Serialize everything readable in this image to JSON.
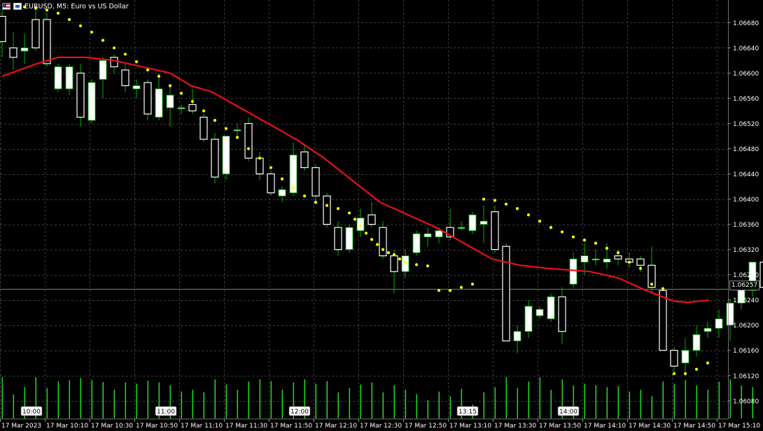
{
  "header": {
    "title": "EURUSD, M5:  Euro vs US Dollar",
    "flag_icon": "eu-us-flag-icon",
    "timeframe_icon": "chart-timeframe-icon"
  },
  "current_price": "1.06257",
  "colors": {
    "background": "#000000",
    "grid": "#3c3c3c",
    "candle_body": "#ffffff",
    "wick": "#00b300",
    "moving_average": "#e8101a",
    "parabolic_sar": "#ffff00",
    "volume": "#24d124",
    "current_price_line": "#6e8c6e"
  },
  "chart_data": {
    "type": "candlestick",
    "symbol": "EURUSD",
    "timeframe": "M5",
    "ylim": [
      1.06052,
      1.06716
    ],
    "y_ticks": [
      "1.06680",
      "1.06640",
      "1.06600",
      "1.06560",
      "1.06520",
      "1.06480",
      "1.06440",
      "1.06400",
      "1.06360",
      "1.06320",
      "1.06280",
      "1.06240",
      "1.06200",
      "1.06160",
      "1.06120",
      "1.06080"
    ],
    "x_ticks": [
      "17 Mar 2023",
      "17 Mar 10:10",
      "17 Mar 10:30",
      "17 Mar 10:50",
      "17 Mar 11:10",
      "17 Mar 11:30",
      "17 Mar 11:50",
      "17 Mar 12:10",
      "17 Mar 12:30",
      "17 Mar 12:50",
      "17 Mar 13:10",
      "17 Mar 13:30",
      "17 Mar 13:50",
      "17 Mar 14:10",
      "17 Mar 14:30",
      "17 Mar 14:50",
      "17 Mar 15:10"
    ],
    "period_separators": [
      "10:00",
      "11:00",
      "12:00",
      "13:15",
      "14:00"
    ],
    "candles": [
      [
        1.0669,
        1.067,
        1.06625,
        1.0665
      ],
      [
        1.0664,
        1.06665,
        1.06605,
        1.06625
      ],
      [
        1.06635,
        1.06662,
        1.06615,
        1.0664
      ],
      [
        1.06685,
        1.067,
        1.06635,
        1.0664
      ],
      [
        1.06685,
        1.06695,
        1.0661,
        1.06615
      ],
      [
        1.06575,
        1.06615,
        1.0657,
        1.0661
      ],
      [
        1.06575,
        1.06615,
        1.06565,
        1.0661
      ],
      [
        1.066,
        1.06615,
        1.06515,
        1.0653
      ],
      [
        1.06525,
        1.0659,
        1.0652,
        1.06585
      ],
      [
        1.0659,
        1.06625,
        1.0656,
        1.0662
      ],
      [
        1.06625,
        1.0663,
        1.066,
        1.0661
      ],
      [
        1.06605,
        1.06615,
        1.0657,
        1.0658
      ],
      [
        1.06575,
        1.0659,
        1.0656,
        1.0658
      ],
      [
        1.06585,
        1.0659,
        1.06525,
        1.06535
      ],
      [
        1.0653,
        1.066,
        1.06525,
        1.06575
      ],
      [
        1.06545,
        1.0658,
        1.06515,
        1.06565
      ],
      [
        1.06545,
        1.0655,
        1.06535,
        1.06545
      ],
      [
        1.0655,
        1.06575,
        1.06535,
        1.0654
      ],
      [
        1.0653,
        1.06535,
        1.0649,
        1.06495
      ],
      [
        1.06495,
        1.06505,
        1.06425,
        1.06435
      ],
      [
        1.0644,
        1.065,
        1.0643,
        1.065
      ],
      [
        1.0651,
        1.0652,
        1.06495,
        1.0651
      ],
      [
        1.0652,
        1.0653,
        1.0646,
        1.06465
      ],
      [
        1.06465,
        1.06475,
        1.0643,
        1.0644
      ],
      [
        1.0644,
        1.06445,
        1.06405,
        1.0641
      ],
      [
        1.06405,
        1.0642,
        1.06395,
        1.06415
      ],
      [
        1.0641,
        1.0649,
        1.06405,
        1.0647
      ],
      [
        1.06475,
        1.06485,
        1.06445,
        1.0645
      ],
      [
        1.0645,
        1.06455,
        1.06395,
        1.06405
      ],
      [
        1.06405,
        1.0641,
        1.06355,
        1.0636
      ],
      [
        1.06355,
        1.06365,
        1.0631,
        1.0632
      ],
      [
        1.0632,
        1.0636,
        1.06315,
        1.06355
      ],
      [
        1.0635,
        1.06385,
        1.0634,
        1.0637
      ],
      [
        1.06375,
        1.06395,
        1.06355,
        1.0636
      ],
      [
        1.06355,
        1.06365,
        1.06305,
        1.0631
      ],
      [
        1.0631,
        1.0632,
        1.0625,
        1.06285
      ],
      [
        1.06285,
        1.0632,
        1.06275,
        1.0631
      ],
      [
        1.06315,
        1.0635,
        1.0631,
        1.06345
      ],
      [
        1.0634,
        1.06355,
        1.06325,
        1.06345
      ],
      [
        1.0634,
        1.06355,
        1.0633,
        1.0635
      ],
      [
        1.06355,
        1.06385,
        1.06335,
        1.0634
      ],
      [
        1.06355,
        1.06365,
        1.0635,
        1.06355
      ],
      [
        1.0635,
        1.0638,
        1.06345,
        1.06375
      ],
      [
        1.0636,
        1.0639,
        1.0633,
        1.06365
      ],
      [
        1.0638,
        1.0639,
        1.06315,
        1.0632
      ],
      [
        1.06325,
        1.0633,
        1.06175,
        1.06175
      ],
      [
        1.06175,
        1.062,
        1.06155,
        1.0619
      ],
      [
        1.0619,
        1.0624,
        1.0618,
        1.0623
      ],
      [
        1.06215,
        1.0623,
        1.0621,
        1.06225
      ],
      [
        1.0621,
        1.0625,
        1.06205,
        1.06245
      ],
      [
        1.06245,
        1.0626,
        1.0617,
        1.0619
      ],
      [
        1.06265,
        1.06315,
        1.0626,
        1.06305
      ],
      [
        1.063,
        1.0633,
        1.0628,
        1.0631
      ],
      [
        1.06305,
        1.0632,
        1.06295,
        1.06305
      ],
      [
        1.063,
        1.0633,
        1.0629,
        1.06305
      ],
      [
        1.0631,
        1.0632,
        1.06295,
        1.06305
      ],
      [
        1.06305,
        1.06315,
        1.0629,
        1.063
      ],
      [
        1.06305,
        1.0631,
        1.06285,
        1.06295
      ],
      [
        1.06295,
        1.06325,
        1.0625,
        1.0626
      ],
      [
        1.06255,
        1.0626,
        1.0616,
        1.0616
      ],
      [
        1.0616,
        1.06165,
        1.06125,
        1.06135
      ],
      [
        1.0614,
        1.0618,
        1.0612,
        1.0616
      ],
      [
        1.0616,
        1.062,
        1.0615,
        1.06185
      ],
      [
        1.0619,
        1.06205,
        1.0618,
        1.06195
      ],
      [
        1.06195,
        1.06225,
        1.0618,
        1.0621
      ],
      [
        1.062,
        1.0624,
        1.06175,
        1.06235
      ],
      [
        1.06235,
        1.0627,
        1.06225,
        1.0626
      ],
      [
        1.06255,
        1.063,
        1.06245,
        1.063
      ],
      [
        1.063,
        1.0633,
        1.0625,
        1.0626
      ],
      [
        1.06255,
        1.06265,
        1.0625,
        1.06257
      ]
    ],
    "moving_average": [
      [
        0,
        1.06595
      ],
      [
        5,
        1.06615
      ],
      [
        8,
        1.06625
      ],
      [
        12,
        1.06625
      ],
      [
        16,
        1.0662
      ],
      [
        20,
        1.0661
      ],
      [
        24,
        1.066
      ],
      [
        27,
        1.0658
      ],
      [
        30,
        1.0657
      ],
      [
        34,
        1.06545
      ],
      [
        38,
        1.0652
      ],
      [
        42,
        1.06495
      ],
      [
        46,
        1.06465
      ],
      [
        50,
        1.0643
      ],
      [
        54,
        1.06395
      ],
      [
        58,
        1.06375
      ],
      [
        62,
        1.06355
      ],
      [
        66,
        1.0633
      ],
      [
        70,
        1.06305
      ],
      [
        74,
        1.06295
      ],
      [
        78,
        1.0629
      ],
      [
        84,
        1.06285
      ],
      [
        88,
        1.06275
      ],
      [
        92,
        1.06255
      ],
      [
        96,
        1.06238
      ],
      [
        98,
        1.06236
      ],
      [
        101,
        1.0624
      ]
    ],
    "parabolic_sar": [
      [
        4,
        1.06705
      ],
      [
        6,
        1.06703
      ],
      [
        8,
        1.067
      ],
      [
        10,
        1.06695
      ],
      [
        12,
        1.06685
      ],
      [
        14,
        1.06675
      ],
      [
        16,
        1.06665
      ],
      [
        18,
        1.06652
      ],
      [
        20,
        1.0664
      ],
      [
        22,
        1.0663
      ],
      [
        24,
        1.06618
      ],
      [
        26,
        1.06605
      ],
      [
        28,
        1.06595
      ],
      [
        30,
        1.0658
      ],
      [
        32,
        1.06568
      ],
      [
        34,
        1.06555
      ],
      [
        36,
        1.0654
      ],
      [
        38,
        1.06525
      ],
      [
        40,
        1.06512
      ],
      [
        42,
        1.06498
      ],
      [
        44,
        1.0648
      ],
      [
        46,
        1.06465
      ],
      [
        48,
        1.0645
      ],
      [
        50,
        1.06432
      ],
      [
        52,
        1.06418
      ],
      [
        54,
        1.06405
      ],
      [
        56,
        1.06395
      ],
      [
        58,
        1.0639
      ],
      [
        60,
        1.06385
      ],
      [
        62,
        1.06378
      ],
      [
        63,
        1.06368
      ],
      [
        64,
        1.06357
      ],
      [
        65,
        1.06346
      ],
      [
        66,
        1.06336
      ],
      [
        67,
        1.06328
      ],
      [
        68,
        1.0632
      ],
      [
        69,
        1.06315
      ],
      [
        70,
        1.06312
      ],
      [
        71,
        1.06305
      ],
      [
        72,
        1.063
      ],
      [
        74,
        1.06296
      ],
      [
        76,
        1.06294
      ],
      [
        78,
        1.06255
      ],
      [
        80,
        1.06255
      ],
      [
        82,
        1.0626
      ],
      [
        84,
        1.06265
      ],
      [
        86,
        1.064
      ],
      [
        88,
        1.06398
      ],
      [
        90,
        1.06392
      ],
      [
        92,
        1.06385
      ],
      [
        94,
        1.06375
      ],
      [
        96,
        1.06365
      ],
      [
        98,
        1.06355
      ],
      [
        100,
        1.06348
      ],
      [
        102,
        1.0634
      ],
      [
        104,
        1.06335
      ],
      [
        106,
        1.0633
      ],
      [
        108,
        1.06322
      ],
      [
        110,
        1.06315
      ],
      [
        112,
        1.063
      ],
      [
        114,
        1.0629
      ],
      [
        116,
        1.06265
      ],
      [
        118,
        1.06258
      ],
      [
        120,
        1.06123
      ],
      [
        122,
        1.06123
      ],
      [
        124,
        1.0613
      ],
      [
        126,
        1.0614
      ]
    ],
    "volume": [
      0.95,
      0.55,
      0.72,
      0.95,
      0.7,
      0.85,
      0.88,
      0.93,
      0.88,
      0.84,
      0.66,
      0.83,
      0.8,
      0.87,
      0.83,
      0.76,
      0.62,
      0.66,
      0.6,
      0.9,
      0.78,
      0.66,
      0.85,
      0.9,
      0.86,
      0.66,
      0.83,
      0.9,
      0.8,
      0.86,
      0.6,
      0.7,
      0.78,
      0.83,
      0.6,
      0.76,
      0.66,
      0.56,
      0.42,
      0.62,
      0.51,
      0.68,
      0.32,
      0.6,
      0.72,
      0.95,
      0.7,
      0.85,
      0.95,
      0.66,
      0.9,
      0.76,
      0.8,
      0.76,
      0.72,
      0.74,
      0.62,
      0.66,
      0.51,
      0.85,
      0.8,
      0.88,
      0.76,
      0.66,
      0.85,
      0.9,
      0.76,
      0.72,
      0.62,
      0.42
    ]
  }
}
